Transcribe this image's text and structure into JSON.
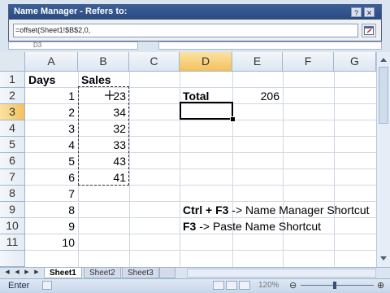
{
  "dialog": {
    "title": "Name Manager - Refers to:",
    "help_label": "?",
    "close_label": "✕",
    "refers_to_value": "=offset(Sheet1!$B$2,0,"
  },
  "namebox": {
    "value": "D3"
  },
  "columns": [
    "A",
    "B",
    "C",
    "D",
    "E",
    "F",
    "G"
  ],
  "rows": [
    "1",
    "2",
    "3",
    "4",
    "5",
    "6",
    "7",
    "8",
    "9",
    "10",
    "11"
  ],
  "cells": {
    "A1": "Days",
    "B1": "Sales",
    "A2": "1",
    "A3": "2",
    "A4": "3",
    "A5": "4",
    "A6": "5",
    "A7": "6",
    "A8": "7",
    "A9": "8",
    "A10": "9",
    "A11": "10",
    "B2": "23",
    "B3": "34",
    "B4": "32",
    "B5": "33",
    "B6": "43",
    "B7": "41",
    "D2": "Total",
    "E2": "206",
    "D9_key": "Ctrl + F3",
    "D9_text": " -> Name Manager Shortcut",
    "D10_key": "F3",
    "D10_text": " -> Paste Name Shortcut"
  },
  "tabs": [
    "Sheet1",
    "Sheet2",
    "Sheet3"
  ],
  "status": {
    "mode": "Enter",
    "zoom": "120%"
  },
  "colors": {
    "selected_header": "#f4c15b",
    "title_bar": "#2b4a80"
  }
}
